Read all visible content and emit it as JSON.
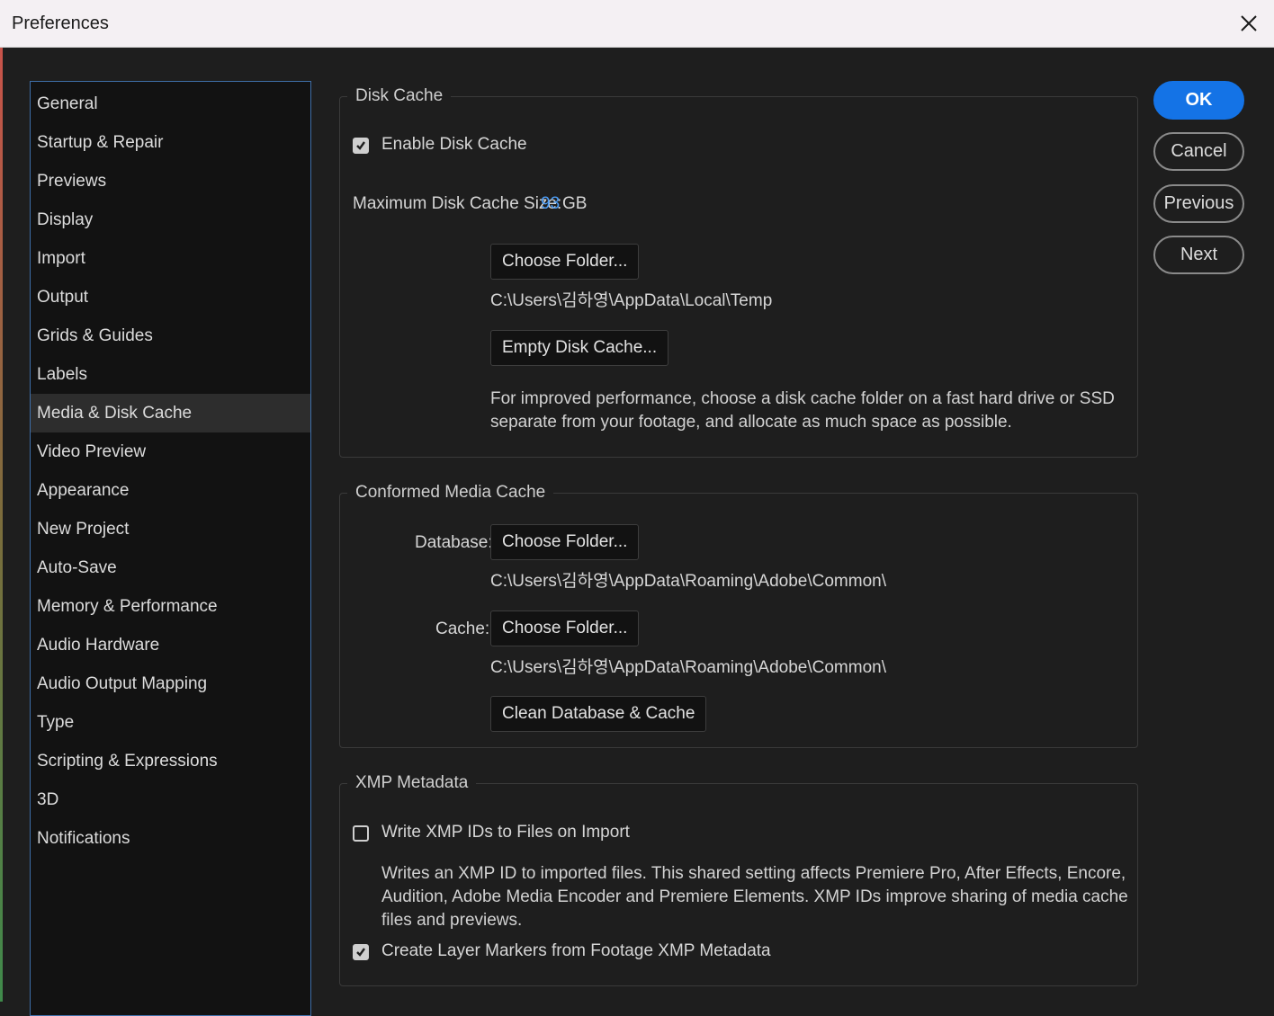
{
  "window": {
    "title": "Preferences"
  },
  "sidebar": {
    "items": [
      {
        "label": "General"
      },
      {
        "label": "Startup & Repair"
      },
      {
        "label": "Previews"
      },
      {
        "label": "Display"
      },
      {
        "label": "Import"
      },
      {
        "label": "Output"
      },
      {
        "label": "Grids & Guides"
      },
      {
        "label": "Labels"
      },
      {
        "label": "Media & Disk Cache",
        "selected": true
      },
      {
        "label": "Video Preview"
      },
      {
        "label": "Appearance"
      },
      {
        "label": "New Project"
      },
      {
        "label": "Auto-Save"
      },
      {
        "label": "Memory & Performance"
      },
      {
        "label": "Audio Hardware"
      },
      {
        "label": "Audio Output Mapping"
      },
      {
        "label": "Type"
      },
      {
        "label": "Scripting & Expressions"
      },
      {
        "label": "3D"
      },
      {
        "label": "Notifications"
      }
    ]
  },
  "disk_cache": {
    "title": "Disk Cache",
    "enable_label": "Enable Disk Cache",
    "enable_checked": true,
    "max_size_label": "Maximum Disk Cache Size:",
    "max_size_value": "93",
    "max_size_unit": "GB",
    "choose_folder_label": "Choose Folder...",
    "folder_path": "C:\\Users\\김하영\\AppData\\Local\\Temp",
    "empty_label": "Empty Disk Cache...",
    "description": "For improved performance, choose a disk cache folder on a fast hard drive or SSD separate from your footage, and allocate as much space as possible."
  },
  "conformed_media_cache": {
    "title": "Conformed Media Cache",
    "database_label": "Database:",
    "database_button": "Choose Folder...",
    "database_path": "C:\\Users\\김하영\\AppData\\Roaming\\Adobe\\Common\\",
    "cache_label": "Cache:",
    "cache_button": "Choose Folder...",
    "cache_path": "C:\\Users\\김하영\\AppData\\Roaming\\Adobe\\Common\\",
    "clean_label": "Clean Database & Cache"
  },
  "xmp_metadata": {
    "title": "XMP Metadata",
    "write_ids_label": "Write XMP IDs to Files on Import",
    "write_ids_checked": false,
    "write_ids_description": "Writes an XMP ID to imported files. This shared setting affects Premiere Pro, After Effects, Encore, Audition, Adobe Media Encoder and Premiere Elements. XMP IDs improve sharing of media cache files and previews.",
    "layer_markers_label": "Create Layer Markers from Footage XMP Metadata",
    "layer_markers_checked": true
  },
  "actions": {
    "ok": "OK",
    "cancel": "Cancel",
    "previous": "Previous",
    "next": "Next"
  },
  "colors": {
    "accent": "#1473e6",
    "highlight_value": "#4b9cf5",
    "sidebar_border": "#3e6ea8"
  }
}
